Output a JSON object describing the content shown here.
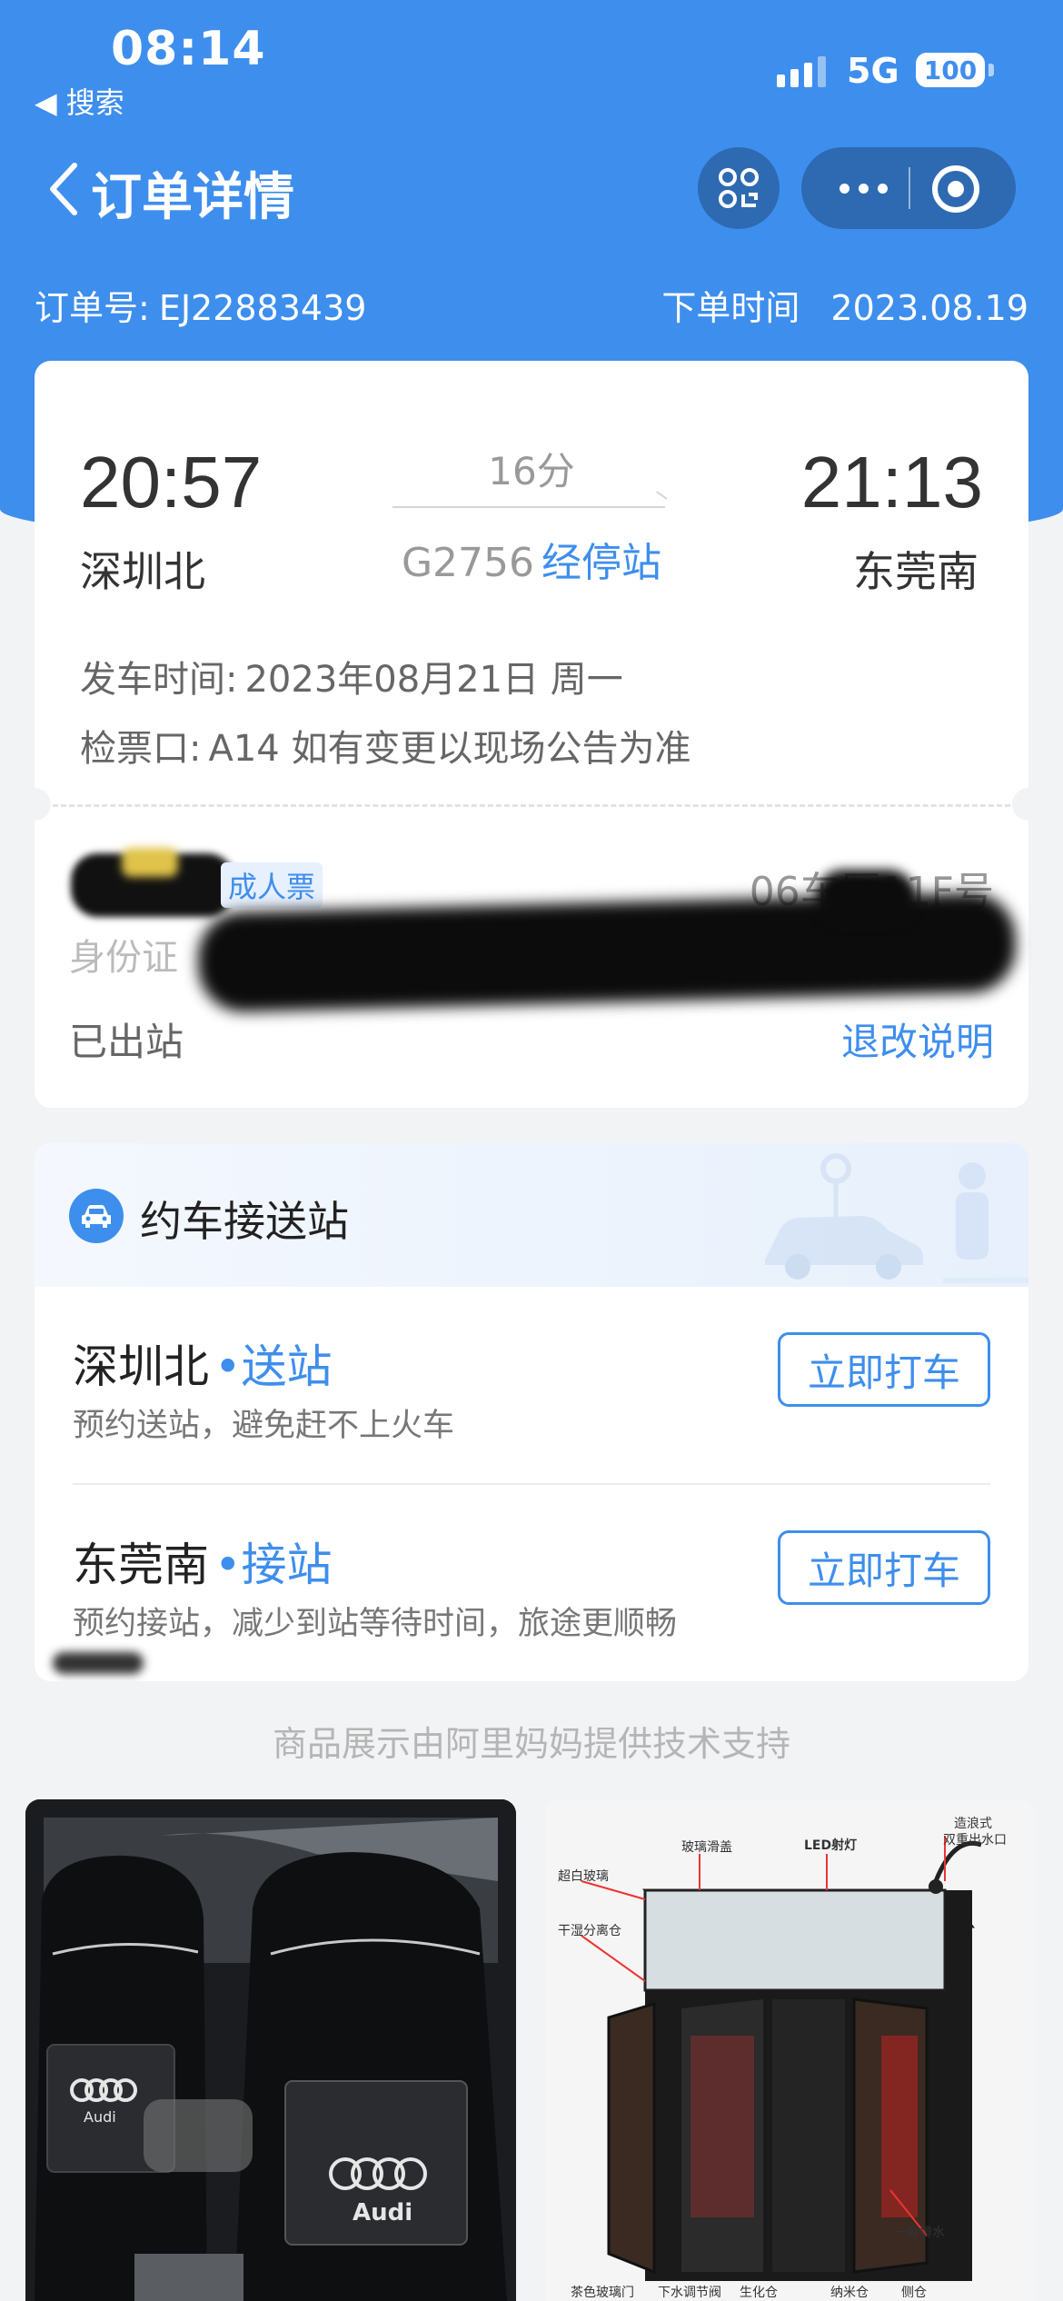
{
  "status_bar": {
    "time": "08:14",
    "back_app": "◀ 搜索",
    "network": "5G",
    "battery": "100"
  },
  "nav": {
    "title": "订单详情"
  },
  "order": {
    "number_label": "订单号:",
    "number": "EJ22883439",
    "time_label": "下单时间",
    "time": "2023.08.19"
  },
  "ticket": {
    "dep_time": "20:57",
    "dep_station": "深圳北",
    "arr_time": "21:13",
    "arr_station": "东莞南",
    "duration": "16分",
    "train_no": "G2756",
    "stops_link": "经停站",
    "depart_label": "发车时间:",
    "depart_value": "2023年08月21日 周一",
    "gate_label": "检票口:",
    "gate_value": "A14  如有变更以现场公告为准",
    "ticket_type": "成人票",
    "seat": "06车厢11F号",
    "id_label": "身份证",
    "status": "已出站",
    "refund_link": "退改说明"
  },
  "ride": {
    "title": "约车接送站",
    "rows": [
      {
        "station": "深圳北",
        "tag": "•送站",
        "desc": "预约送站，避免赶不上火车",
        "button": "立即打车"
      },
      {
        "station": "东莞南",
        "tag": "•接站",
        "desc": "预约接站，减少到站等待时间，旅途更顺畅",
        "button": "立即打车"
      }
    ]
  },
  "powered_by": "商品展示由阿里妈妈提供技术支持",
  "products": {
    "left": {
      "brand": "Audi"
    },
    "right": {
      "labels": [
        "玻璃滑盖",
        "LED射灯",
        "造浪式",
        "双重出水口",
        "超白玻璃",
        "干湿分离仓",
        "一键排水",
        "茶色玻璃门",
        "下水调节阀",
        "生化仓",
        "纳米仓",
        "侧仓"
      ]
    }
  },
  "colors": {
    "primary": "#3e8eed",
    "background": "#f2f3f5"
  },
  "icons": [
    "signal-icon",
    "back-chevron-icon",
    "scan-icon",
    "more-icon",
    "close-capsule-icon",
    "car-icon"
  ]
}
